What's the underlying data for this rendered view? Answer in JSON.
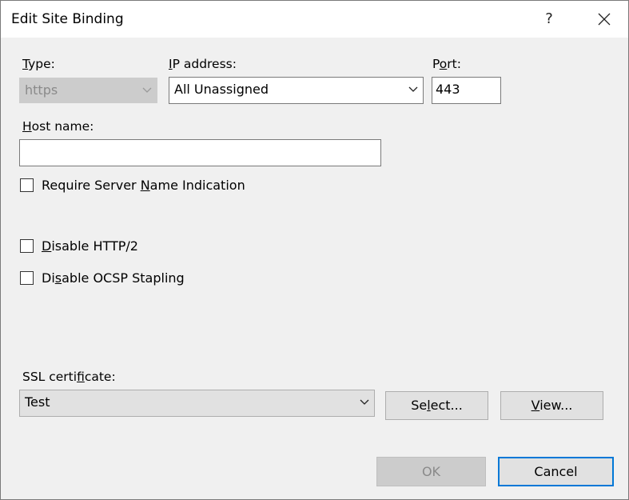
{
  "window": {
    "title": "Edit Site Binding",
    "help_glyph": "?"
  },
  "type": {
    "label_u": "T",
    "label_rest": "ype:",
    "value": "https"
  },
  "ip": {
    "label_u": "I",
    "label_rest": "P address:",
    "value": "All Unassigned"
  },
  "port": {
    "label_pre": "P",
    "label_u": "o",
    "label_rest": "rt:",
    "value": "443"
  },
  "host": {
    "label_u": "H",
    "label_rest": "ost name:",
    "value": ""
  },
  "sni": {
    "label_pre": "Require Server ",
    "label_u": "N",
    "label_rest": "ame Indication",
    "checked": false
  },
  "http2": {
    "label_u": "D",
    "label_rest": "isable HTTP/2",
    "checked": false
  },
  "ocsp": {
    "label_pre": "Di",
    "label_u": "s",
    "label_rest": "able OCSP Stapling",
    "checked": false
  },
  "ssl": {
    "label_pre": "SSL certi",
    "label_u": "f",
    "label_rest": "icate:",
    "value": "Test"
  },
  "buttons": {
    "select_pre": "Se",
    "select_u": "l",
    "select_rest": "ect...",
    "view_u": "V",
    "view_rest": "iew...",
    "ok": "OK",
    "cancel": "Cancel"
  },
  "icons": {
    "close": "close-icon",
    "help": "help-icon",
    "dropdown": "chevron-down-icon"
  }
}
